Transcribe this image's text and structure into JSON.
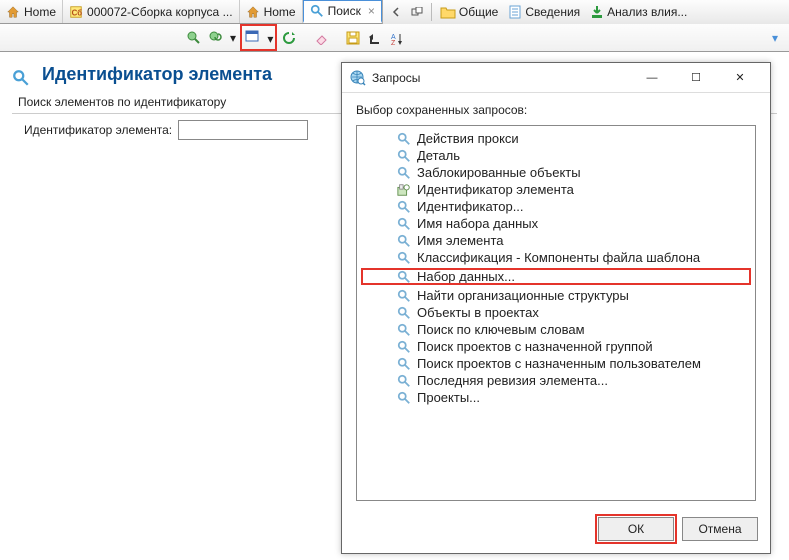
{
  "tabs": [
    {
      "label": "Home"
    },
    {
      "label": "000072-Сборка корпуса ..."
    },
    {
      "label": "Home"
    },
    {
      "label": "Поиск"
    }
  ],
  "ribbon": {
    "general": "Общие",
    "details": "Сведения",
    "impact": "Анализ влия..."
  },
  "page": {
    "title": "Идентификатор элемента",
    "section": "Поиск элементов по идентификатору",
    "field_label": "Идентификатор элемента:"
  },
  "dialog": {
    "title": "Запросы",
    "prompt": "Выбор сохраненных запросов:",
    "items": [
      "Действия прокси",
      "Деталь",
      "Заблокированные объекты",
      "Идентификатор элемента",
      "Идентификатор...",
      "Имя набора данных",
      "Имя элемента",
      "Классификация - Компоненты файла шаблона",
      "Набор данных...",
      "Найти организационные структуры",
      "Объекты в проектах",
      "Поиск по ключевым словам",
      "Поиск проектов с назначенной группой",
      "Поиск проектов с назначенным пользователем",
      "Последняя ревизия элемента...",
      "Проекты..."
    ],
    "highlight_index": 8,
    "special_icon_index": 3,
    "ok": "ОК",
    "cancel": "Отмена"
  }
}
